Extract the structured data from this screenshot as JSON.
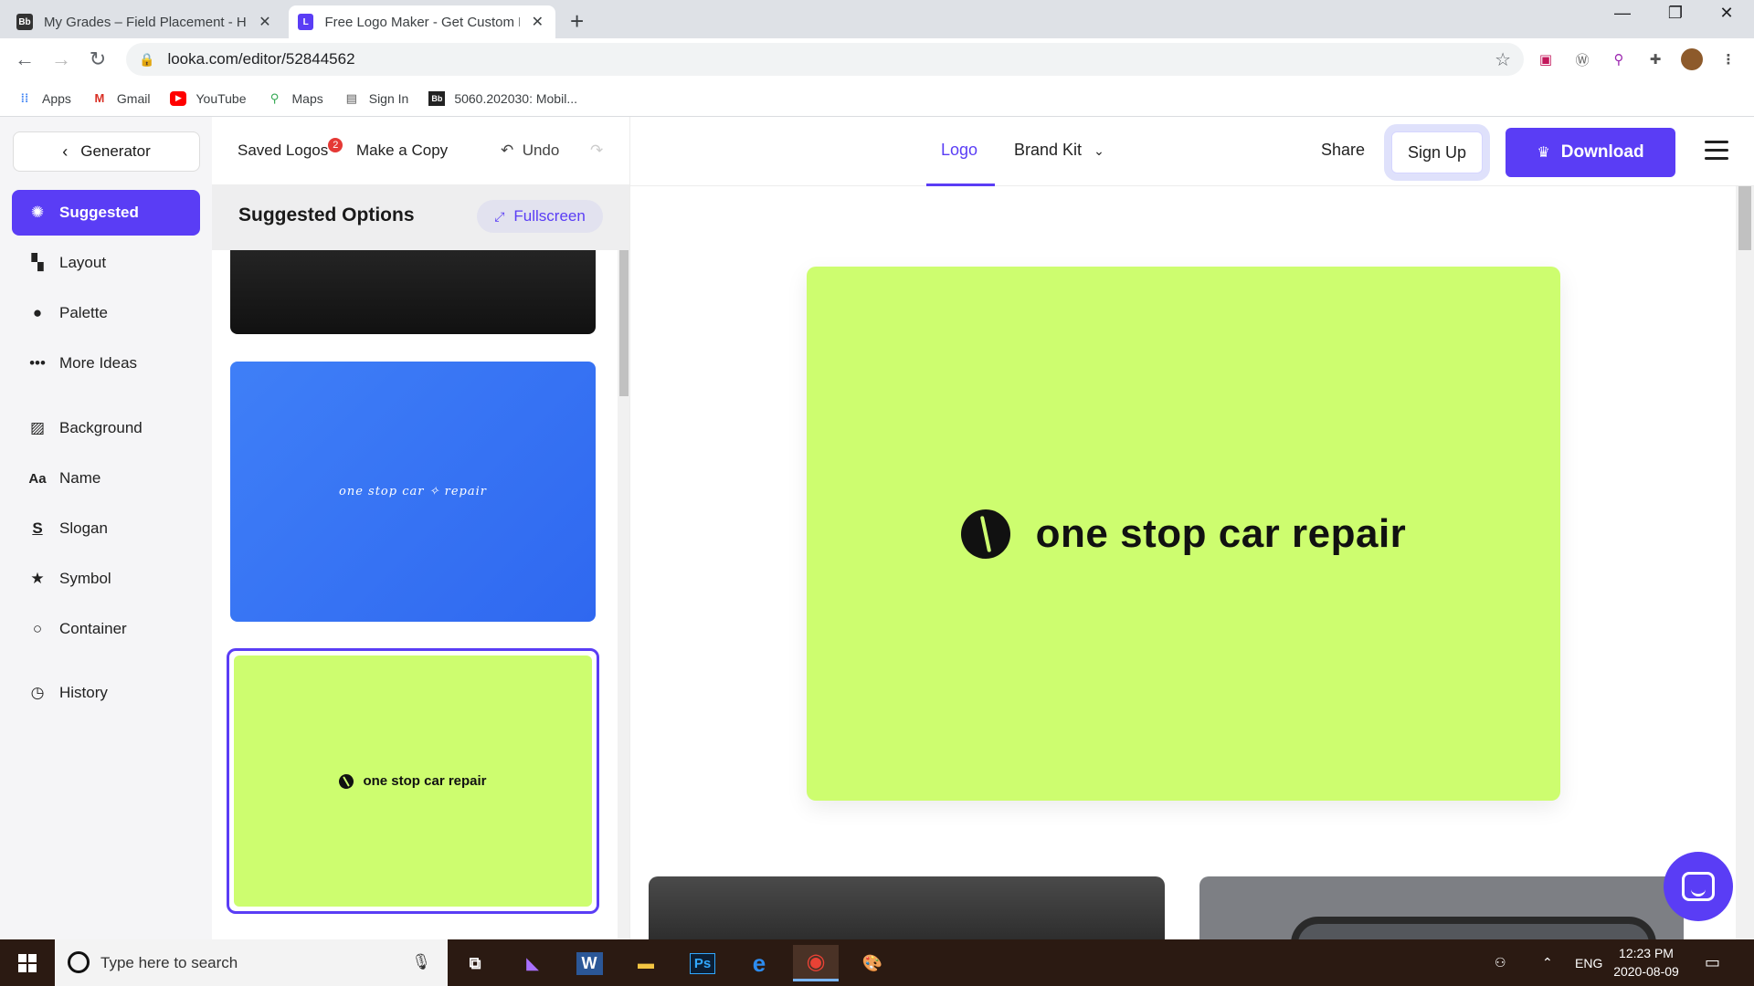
{
  "browser": {
    "tabs": [
      {
        "title": "My Grades – Field Placement - H",
        "favicon": "Bb"
      },
      {
        "title": "Free Logo Maker - Get Custom Lo",
        "favicon": "L"
      }
    ],
    "url": "looka.com/editor/52844562",
    "bookmarks": [
      {
        "label": "Apps",
        "icon": "apps-grid-icon"
      },
      {
        "label": "Gmail",
        "icon": "gmail-icon"
      },
      {
        "label": "YouTube",
        "icon": "youtube-icon"
      },
      {
        "label": "Maps",
        "icon": "maps-pin-icon"
      },
      {
        "label": "Sign In",
        "icon": "page-icon"
      },
      {
        "label": "5060.202030: Mobil...",
        "icon": "blackboard-icon"
      }
    ]
  },
  "sidebar": {
    "generator_label": "Generator",
    "items": [
      {
        "label": "Suggested",
        "icon": "sparkle-icon",
        "active": true
      },
      {
        "label": "Layout",
        "icon": "layout-icon"
      },
      {
        "label": "Palette",
        "icon": "drop-icon"
      },
      {
        "label": "More Ideas",
        "icon": "dots-icon"
      },
      {
        "label": "Background",
        "icon": "background-icon"
      },
      {
        "label": "Name",
        "icon": "text-icon"
      },
      {
        "label": "Slogan",
        "icon": "slogan-icon"
      },
      {
        "label": "Symbol",
        "icon": "star-icon"
      },
      {
        "label": "Container",
        "icon": "circle-icon"
      },
      {
        "label": "History",
        "icon": "clock-icon"
      }
    ]
  },
  "options": {
    "saved_logos_label": "Saved Logos",
    "saved_logos_count": "2",
    "make_copy_label": "Make a Copy",
    "undo_label": "Undo",
    "title": "Suggested Options",
    "fullscreen_label": "Fullscreen",
    "blue_card_text": "one stop car ✧ repair",
    "green_card_text": "one stop car repair"
  },
  "topnav": {
    "logo_tab": "Logo",
    "brand_kit_tab": "Brand Kit",
    "share_label": "Share",
    "signup_label": "Sign Up",
    "download_label": "Download"
  },
  "preview": {
    "company_name": "one stop car repair",
    "background_color": "#cdfd6f"
  },
  "taskbar": {
    "search_placeholder": "Type here to search",
    "language": "ENG",
    "time": "12:23 PM",
    "date": "2020-08-09"
  },
  "colors": {
    "accent": "#5a3df5",
    "logo_bg": "#cdfd6f",
    "blue_card": "#3474f5"
  }
}
